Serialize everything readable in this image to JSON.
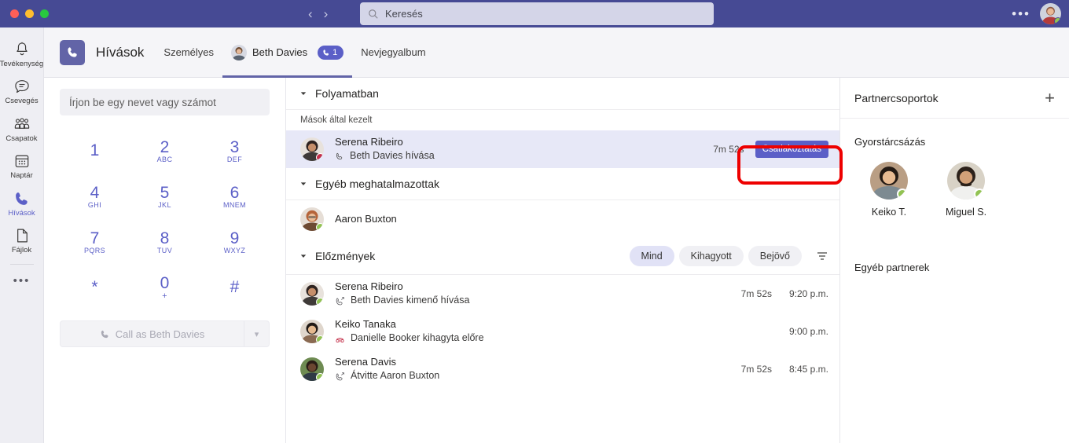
{
  "window": {
    "traffic_lights": [
      "close",
      "minimize",
      "maximize"
    ]
  },
  "topbar": {
    "back_icon": "chevron-left-icon",
    "forward_icon": "chevron-right-icon",
    "search_icon": "search-icon",
    "search_placeholder": "Keresés",
    "search_value": "",
    "more_label": "•••",
    "avatar_name": "me-avatar",
    "presence": "available",
    "bg_color": "#464a94"
  },
  "rail": {
    "items": [
      {
        "label": "Tevékenység",
        "icon": "bell-icon",
        "active": false
      },
      {
        "label": "Csevegés",
        "icon": "chat-icon",
        "active": false
      },
      {
        "label": "Csapatok",
        "icon": "people-icon",
        "active": false
      },
      {
        "label": "Naptár",
        "icon": "calendar-icon",
        "active": false
      },
      {
        "label": "Hívások",
        "icon": "phone-icon",
        "active": true
      },
      {
        "label": "Fájlok",
        "icon": "file-icon",
        "active": false
      }
    ],
    "more_label": "•••"
  },
  "appheader": {
    "app_icon": "phone-icon",
    "title": "Hívások",
    "tabs": [
      {
        "label": "Személyes",
        "active": false,
        "avatar": false,
        "badge": null
      },
      {
        "label": "Beth Davies",
        "active": true,
        "avatar": true,
        "badge": "1",
        "badge_icon": "phone-icon"
      },
      {
        "label": "Nevjegyalbum",
        "active": false,
        "avatar": false,
        "badge": null
      }
    ]
  },
  "dialpad": {
    "input_placeholder": "Írjon be egy nevet vagy számot",
    "input_value": "",
    "keys": [
      {
        "digit": "1",
        "sub": ""
      },
      {
        "digit": "2",
        "sub": "ABC"
      },
      {
        "digit": "3",
        "sub": "DEF"
      },
      {
        "digit": "4",
        "sub": "GHI"
      },
      {
        "digit": "5",
        "sub": "JKL"
      },
      {
        "digit": "6",
        "sub": "MNEM"
      },
      {
        "digit": "7",
        "sub": "PQRS"
      },
      {
        "digit": "8",
        "sub": "TUV"
      },
      {
        "digit": "9",
        "sub": "WXYZ"
      },
      {
        "digit": "*",
        "sub": ""
      },
      {
        "digit": "0",
        "sub": "+"
      },
      {
        "digit": "#",
        "sub": ""
      }
    ],
    "call_button_label": "Call as Beth Davies",
    "call_button_icon": "phone-icon",
    "call_button_caret": "chevron-down-icon"
  },
  "main": {
    "inprogress": {
      "section_title": "Folyamatban",
      "subsection_title": "Mások által kezelt",
      "row": {
        "name": "Serena Ribeiro",
        "detail": "Beth Davies hívása",
        "detail_icon": "phone-icon",
        "presence": "busy",
        "duration": "7m 52s",
        "join_label": "Csatlakoztatás"
      }
    },
    "delegates": {
      "section_title": "Egyéb meghatalmazottak",
      "rows": [
        {
          "name": "Aaron Buxton",
          "presence": "available"
        }
      ]
    },
    "history": {
      "section_title": "Előzmények",
      "filters": [
        {
          "label": "Mind",
          "selected": true
        },
        {
          "label": "Kihagyott",
          "selected": false
        },
        {
          "label": "Bejövő",
          "selected": false
        }
      ],
      "filter_icon": "filter-icon",
      "rows": [
        {
          "name": "Serena Ribeiro",
          "detail": "Beth Davies kimenő hívása",
          "detail_icon": "call-outgoing-icon",
          "presence": "available",
          "duration": "7m 52s",
          "time": "9:20 p.m."
        },
        {
          "name": "Keiko Tanaka",
          "detail": "Danielle Booker kihagyta előre",
          "detail_icon": "call-missed-icon",
          "presence": "available",
          "duration": "",
          "time": "9:00 p.m."
        },
        {
          "name": "Serena Davis",
          "detail": "Átvitte Aaron Buxton",
          "detail_icon": "call-outgoing-icon",
          "presence": "available",
          "duration": "7m 52s",
          "time": "8:45 p.m."
        }
      ]
    }
  },
  "side": {
    "title": "Partnercsoportok",
    "add_icon": "plus-icon",
    "groups": [
      {
        "label": "Gyorstárcsázás",
        "contacts": [
          {
            "name": "Keiko T.",
            "presence": "available"
          },
          {
            "name": "Miguel S.",
            "presence": "available"
          }
        ]
      },
      {
        "label": "Egyéb partnerek",
        "contacts": []
      }
    ]
  },
  "annotation": {
    "type": "highlight-box",
    "color": "#ee0000",
    "targets": [
      "call duration",
      "Csatlakoztatás button"
    ]
  }
}
